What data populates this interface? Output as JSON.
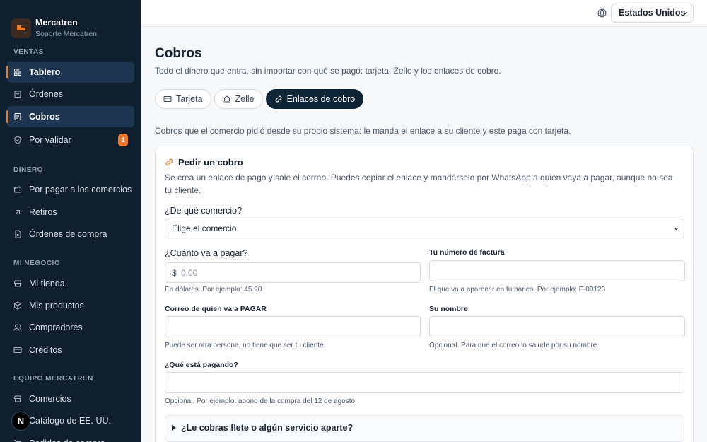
{
  "brand": {
    "name": "Mercatren",
    "subtitle": "Soporte Mercatren"
  },
  "sidebar": {
    "sections": [
      {
        "title": "VENTAS",
        "items": [
          {
            "label": "Tablero",
            "icon": "dashboard-icon",
            "active": true
          },
          {
            "label": "Órdenes",
            "icon": "bag-icon"
          },
          {
            "label": "Cobros",
            "icon": "receipt-icon",
            "active": true
          },
          {
            "label": "Por validar",
            "icon": "shield-check-icon",
            "badge": "1"
          }
        ]
      },
      {
        "title": "DINERO",
        "items": [
          {
            "label": "Por pagar a los comercios",
            "icon": "wallet-icon"
          },
          {
            "label": "Retiros",
            "icon": "arrow-up-right-icon"
          },
          {
            "label": "Órdenes de compra",
            "icon": "document-icon"
          }
        ]
      },
      {
        "title": "MI NEGOCIO",
        "items": [
          {
            "label": "Mi tienda",
            "icon": "store-icon"
          },
          {
            "label": "Mis productos",
            "icon": "box-icon"
          },
          {
            "label": "Compradores",
            "icon": "users-icon"
          },
          {
            "label": "Créditos",
            "icon": "card-icon"
          }
        ]
      },
      {
        "title": "EQUIPO MERCATREN",
        "items": [
          {
            "label": "Comercios",
            "icon": "store-icon"
          },
          {
            "label": "Catálogo de EE. UU.",
            "icon": "catalog-icon"
          },
          {
            "label": "Pedidos de compra",
            "icon": "cart-icon"
          }
        ]
      }
    ],
    "floating_badge": "N"
  },
  "topbar": {
    "country": "Estados Unidos"
  },
  "page": {
    "title": "Cobros",
    "subtitle": "Todo el dinero que entra, sin importar con qué se pagó: tarjeta, Zelle y los enlaces de cobro.",
    "tabs": [
      {
        "label": "Tarjeta",
        "icon": "card-icon"
      },
      {
        "label": "Zelle",
        "icon": "bank-icon"
      },
      {
        "label": "Enlaces de cobro",
        "icon": "link-icon",
        "active": true
      }
    ],
    "intro": "Cobros que el comercio pidió desde su propio sistema: le manda el enlace a su cliente y este paga con tarjeta."
  },
  "form": {
    "title": "Pedir un cobro",
    "description": "Se crea un enlace de pago y sale el correo. Puedes copiar el enlace y mandárselo por WhatsApp a quien vaya a pagar, aunque no sea tu cliente.",
    "merchant_label": "¿De qué comercio?",
    "merchant_value": "Elige el comercio",
    "amount_label": "¿Cuánto va a pagar?",
    "amount_currency": "$",
    "amount_placeholder": "0.00",
    "amount_hint": "En dólares. Por ejemplo: 45.90",
    "invoice_label": "Tu número de factura",
    "invoice_hint": "El que va a aparecer en tu banco. Por ejemplo: F-00123",
    "email_label": "Correo de quien va a PAGAR",
    "email_hint": "Puede ser otra persona, no tiene que ser tu cliente.",
    "name_label": "Su nombre",
    "name_hint": "Opcional. Para que el correo lo salude por su nombre.",
    "concept_label": "¿Qué está pagando?",
    "concept_hint": "Opcional. Por ejemplo: abono de la compra del 12 de agosto.",
    "extra_toggle": "¿Le cobras flete o algún servicio aparte?"
  }
}
